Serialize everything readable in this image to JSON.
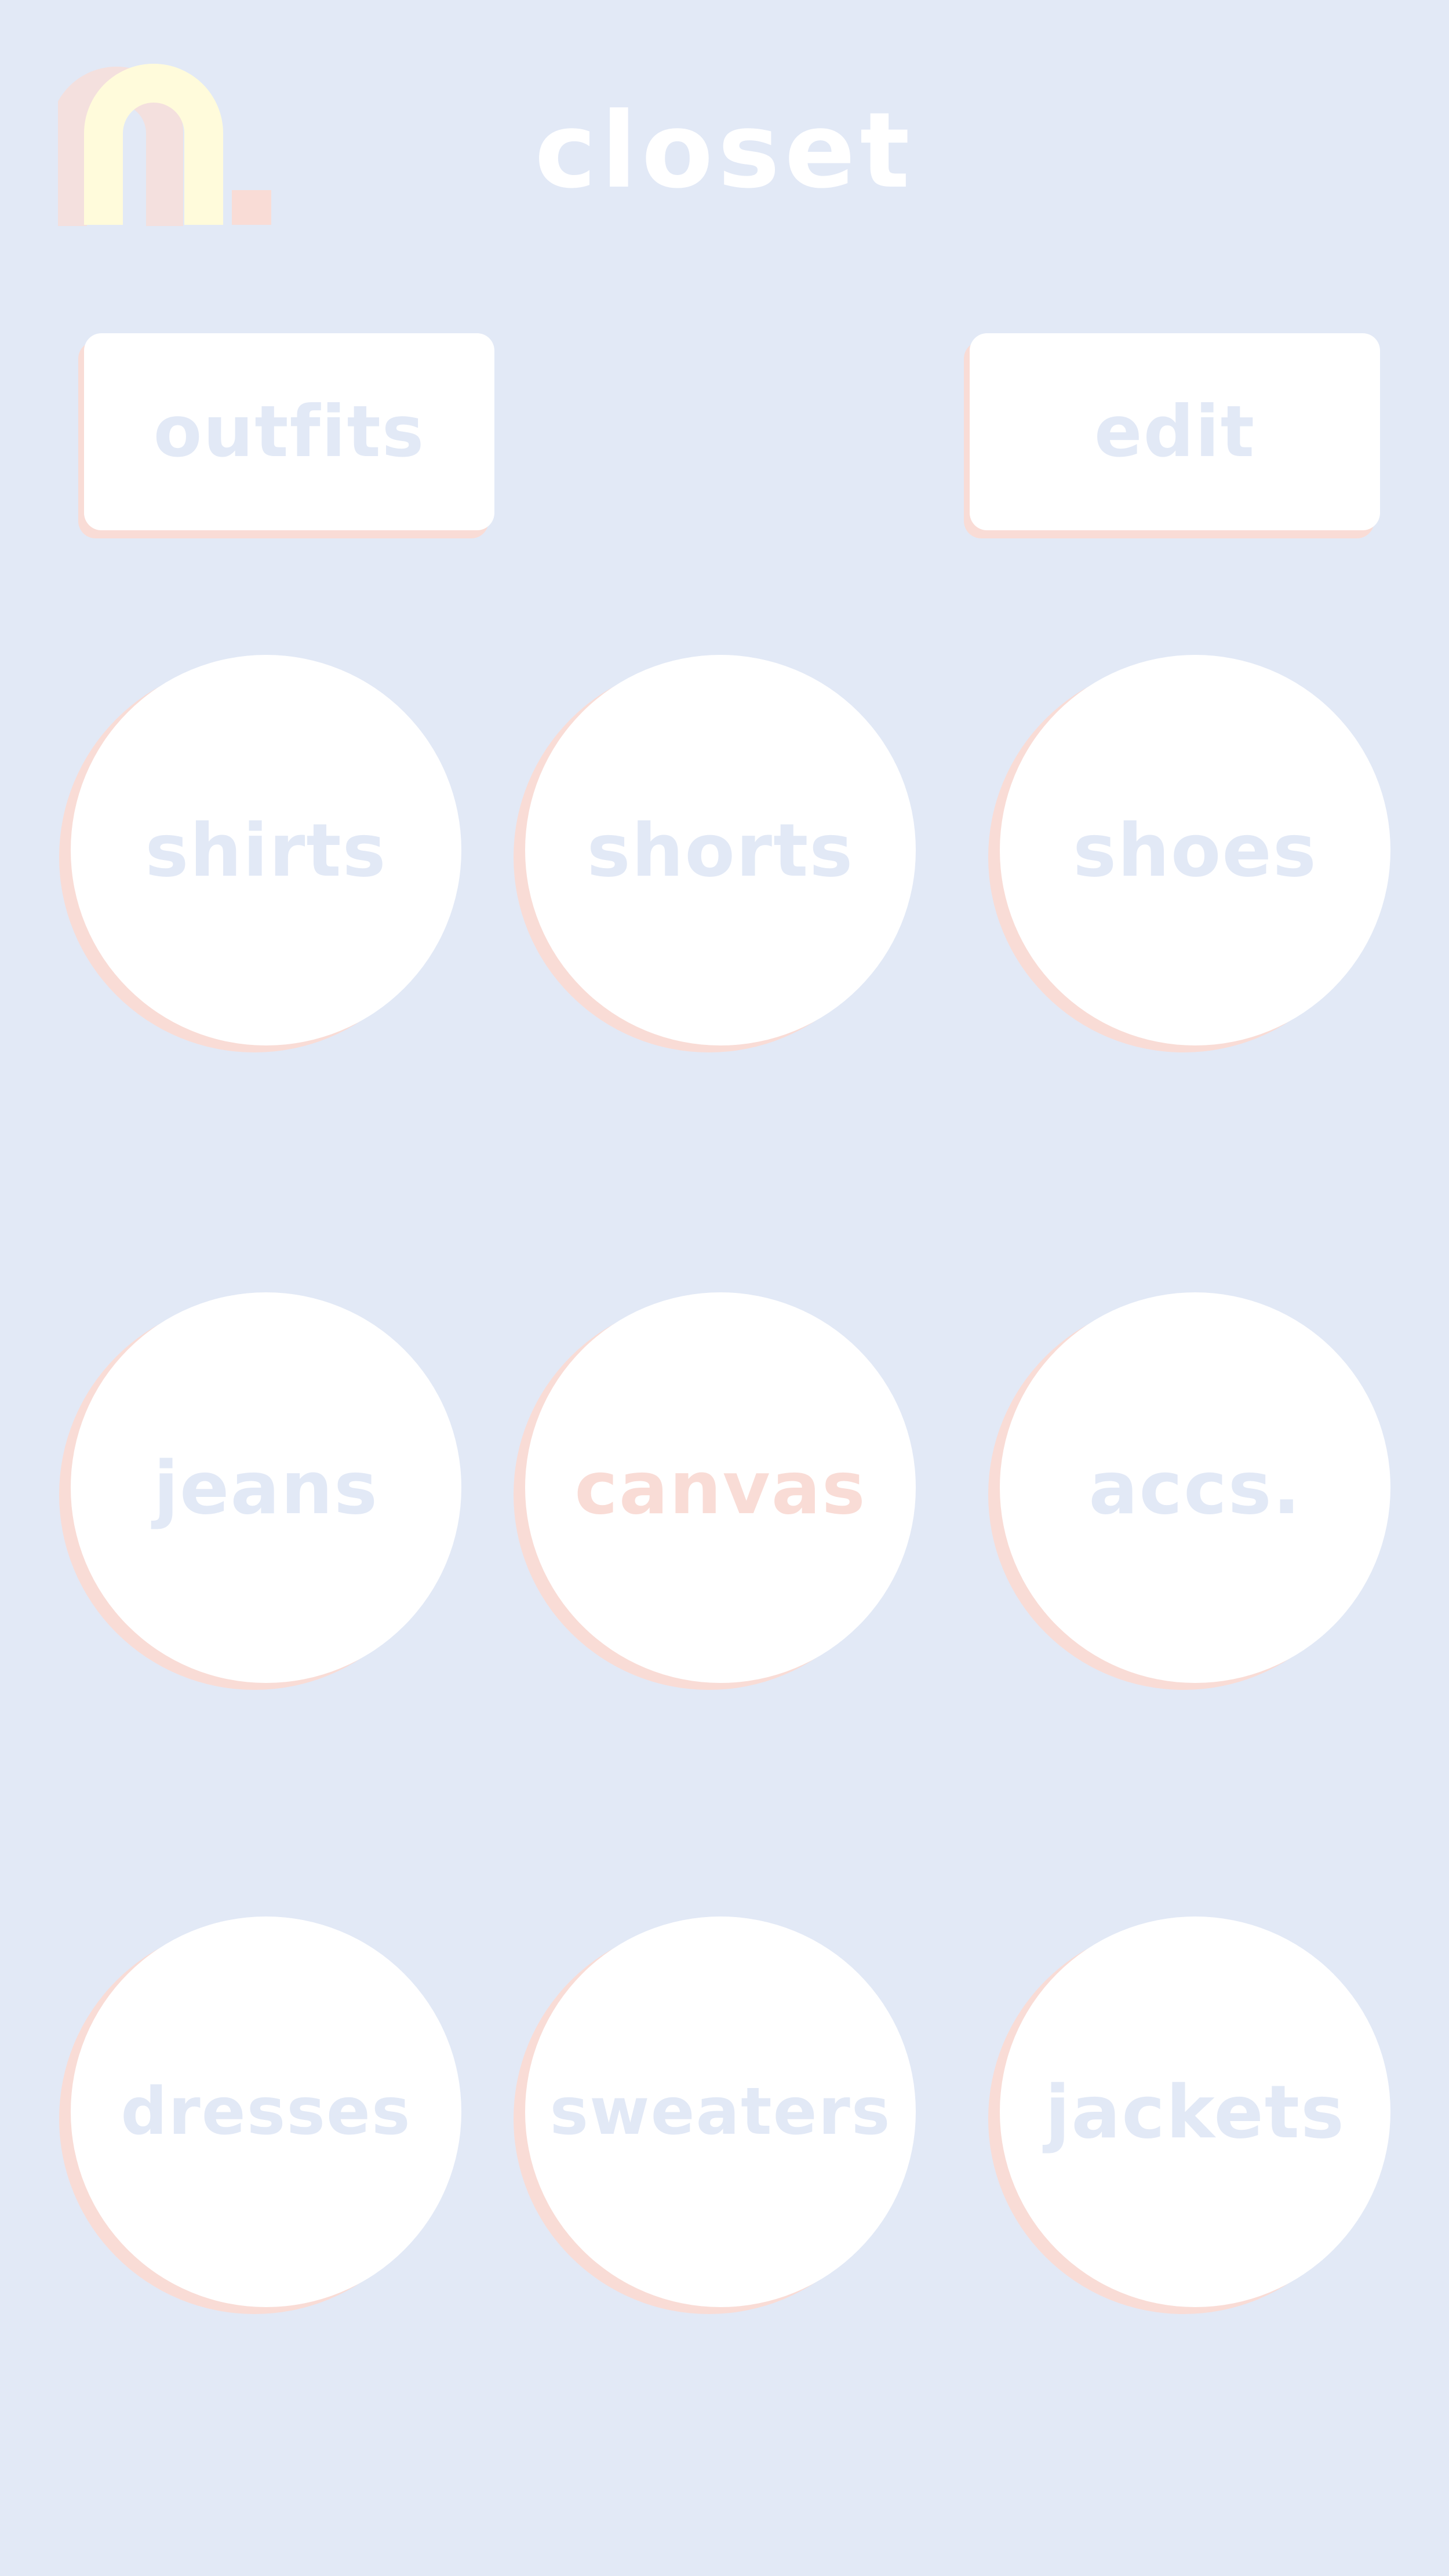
{
  "header": {
    "title": "closet",
    "logo_icon": "n-arch-logo-icon"
  },
  "actions": {
    "outfits_label": "outfits",
    "edit_label": "edit"
  },
  "categories": [
    {
      "label": "shirts"
    },
    {
      "label": "shorts"
    },
    {
      "label": "shoes"
    },
    {
      "label": "jeans"
    },
    {
      "label": "canvas"
    },
    {
      "label": "accs."
    },
    {
      "label": "dresses"
    },
    {
      "label": "sweaters"
    },
    {
      "label": "jackets"
    }
  ],
  "colors": {
    "background": "#e2e9f6",
    "surface": "#ffffff",
    "accent_pink": "#f9dcd6",
    "logo_yellow": "#fffbdb"
  }
}
